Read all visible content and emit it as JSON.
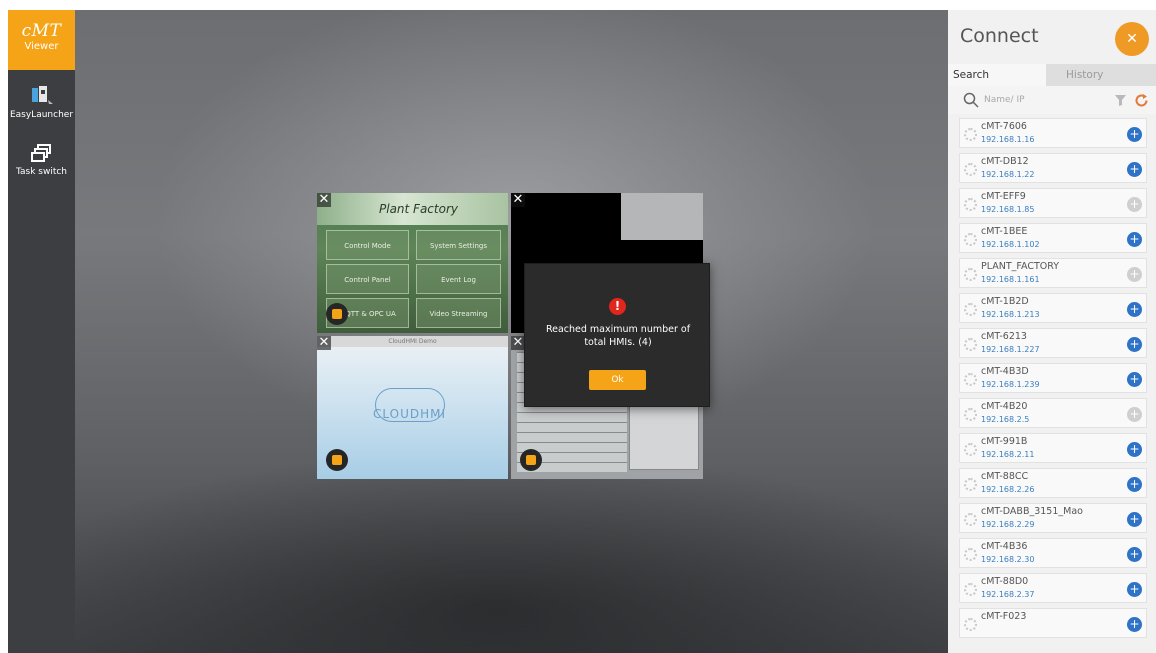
{
  "app": {
    "logo_text": "cMT",
    "logo_sub": "Viewer",
    "accent_color": "#f6a417"
  },
  "sidebar": {
    "items": [
      {
        "label": "EasyLauncher",
        "icon": "easylauncher-icon"
      },
      {
        "label": "Task switch",
        "icon": "task-switch-icon"
      }
    ]
  },
  "tiles": {
    "plant_factory": {
      "title": "Plant Factory",
      "buttons": [
        "Control Mode",
        "System Settings",
        "Control Panel",
        "Event Log",
        "MQTT & OPC UA",
        "Video Streaming Mobile Data"
      ]
    },
    "cloudhmi": {
      "bar_title": "CloudHMI Demo",
      "logo_text": "CLOUDHMI"
    }
  },
  "dialog": {
    "icon": "error-icon",
    "message": "Reached maximum number of total HMIs. (4)",
    "ok_label": "Ok"
  },
  "connect": {
    "title": "Connect",
    "close_icon": "close-icon",
    "tabs": [
      "Search",
      "History"
    ],
    "search_placeholder": "Name/ IP",
    "devices": [
      {
        "name": "cMT-7606",
        "ip": "192.168.1.16",
        "enabled": true
      },
      {
        "name": "cMT-DB12",
        "ip": "192.168.1.22",
        "enabled": true
      },
      {
        "name": "cMT-EFF9",
        "ip": "192.168.1.85",
        "enabled": false
      },
      {
        "name": "cMT-1BEE",
        "ip": "192.168.1.102",
        "enabled": true
      },
      {
        "name": "PLANT_FACTORY",
        "ip": "192.168.1.161",
        "enabled": false
      },
      {
        "name": "cMT-1B2D",
        "ip": "192.168.1.213",
        "enabled": true
      },
      {
        "name": "cMT-6213",
        "ip": "192.168.1.227",
        "enabled": true
      },
      {
        "name": "cMT-4B3D",
        "ip": "192.168.1.239",
        "enabled": true
      },
      {
        "name": "cMT-4B20",
        "ip": "192.168.2.5",
        "enabled": false
      },
      {
        "name": "cMT-991B",
        "ip": "192.168.2.11",
        "enabled": true
      },
      {
        "name": "cMT-88CC",
        "ip": "192.168.2.26",
        "enabled": true
      },
      {
        "name": "cMT-DABB_3151_Mao",
        "ip": "192.168.2.29",
        "enabled": true
      },
      {
        "name": "cMT-4B36",
        "ip": "192.168.2.30",
        "enabled": true
      },
      {
        "name": "cMT-88D0",
        "ip": "192.168.2.37",
        "enabled": true
      },
      {
        "name": "cMT-F023",
        "ip": "",
        "enabled": true
      }
    ]
  }
}
